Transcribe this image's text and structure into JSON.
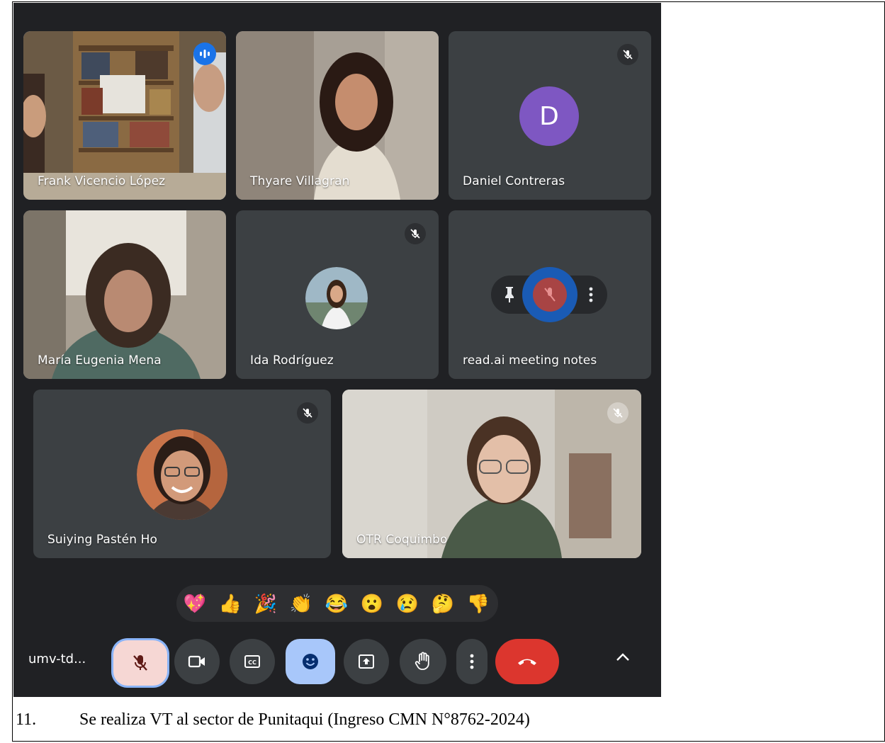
{
  "participants": {
    "frank": "Frank Vicencio López",
    "thyare": "Thyare Villagran",
    "daniel": "Daniel Contreras",
    "daniel_initial": "D",
    "maria": "María Eugenia Mena",
    "ida": "Ida Rodríguez",
    "readai": "read.ai meeting notes",
    "suiying": "Suiying Pastén Ho",
    "otr": "OTR Coquimbo"
  },
  "controls": {
    "meeting_code": "umv-td..."
  },
  "reactions": [
    "💖",
    "👍",
    "🎉",
    "👏",
    "😂",
    "😮",
    "😢",
    "🤔",
    "👎"
  ],
  "caption": {
    "number": "11.",
    "text": "Se realiza VT al sector de Punitaqui (Ingreso CMN N°8762-2024)"
  },
  "colors": {
    "meeting_bg": "#202124",
    "tile_bg": "#3c4043",
    "speaking_border": "#8ab4f8",
    "leave_red": "#dc362e",
    "avatar_purple": "#7e57c2"
  }
}
